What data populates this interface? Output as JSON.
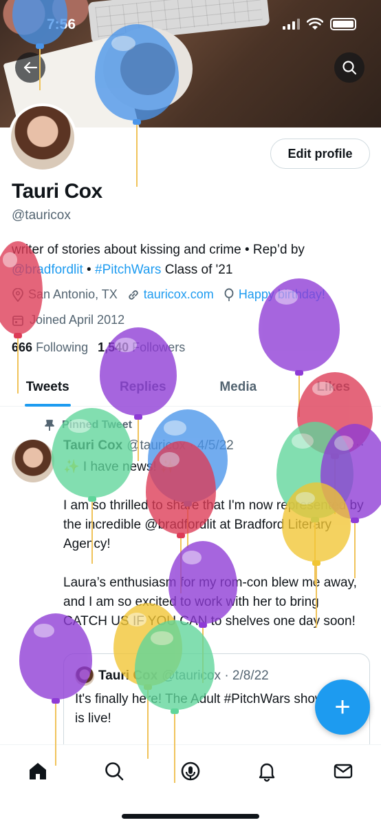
{
  "status": {
    "time": "7:56"
  },
  "profile": {
    "name": "Tauri Cox",
    "handle": "@tauricox",
    "edit_label": "Edit profile",
    "bio_part1": "writer of stories about kissing and crime • Rep’d by ",
    "bio_link1": "@bradfordlit",
    "bio_part2": " • ",
    "bio_link2": "#PitchWars",
    "bio_part3": " Class of '21",
    "location": "San Antonio, TX",
    "website": "tauricox.com",
    "birthday": "Happy birthday!",
    "joined": "Joined April 2012",
    "following_count": "666",
    "following_label": "Following",
    "followers_count": "1,540",
    "followers_label": "Followers"
  },
  "tabs": [
    "Tweets",
    "Replies",
    "Media",
    "Likes"
  ],
  "tweet": {
    "pinned_label": "Pinned Tweet",
    "author": "Tauri Cox",
    "handle_date": "@tauricox · 4/5/22",
    "line1": "✨ I have news! ✨",
    "para1": "I am so thrilled to share that I'm now represented by the incredible @bradfordlit at Bradford Literary Agency!",
    "para2": "Laura’s enthusiasm for my rom-con blew me away, and I am so excited to work with her to bring CATCH US IF YOU CAN to shelves one day soon!",
    "more": "···"
  },
  "quote": {
    "author": "Tauri Cox",
    "handle_date": "@tauricox · 2/8/22",
    "text": "It's finally here! The Adult #PitchWars showcase is live!"
  },
  "fab": {
    "label": "+"
  },
  "colors": {
    "accent": "#1d9bf0",
    "balloon_purple": "#8e3bd6",
    "balloon_blue": "#4a95ea",
    "balloon_green": "#5fd59a",
    "balloon_red": "#dd3b56",
    "balloon_yellow": "#f1c533"
  },
  "nav": [
    "home-icon",
    "search-icon",
    "spaces-icon",
    "notifications-icon",
    "messages-icon"
  ]
}
